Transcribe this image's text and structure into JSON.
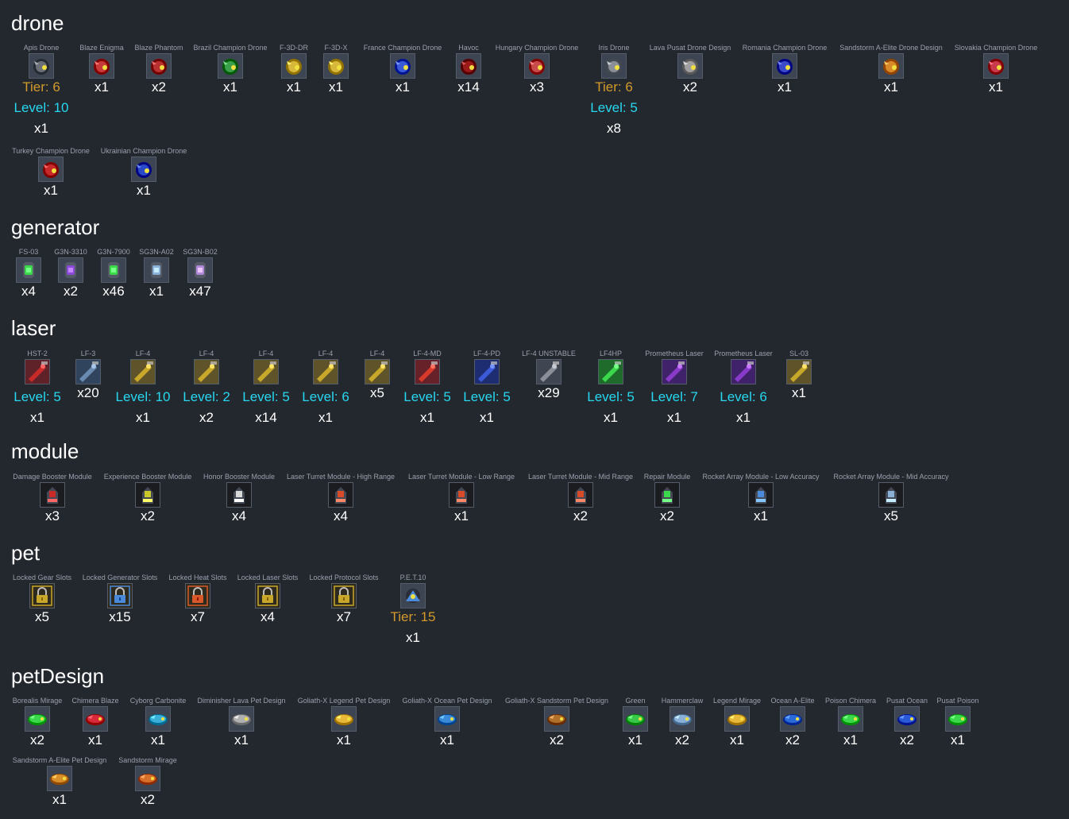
{
  "categories": [
    {
      "id": "drone",
      "title": "drone",
      "items": [
        {
          "name": "Apis Drone",
          "tier": "Tier: 6",
          "level": "Level: 10",
          "count": "x1",
          "icon": "apis-drone-icon",
          "color": "#6b6f77"
        },
        {
          "name": "Blaze Enigma",
          "count": "x1",
          "icon": "blaze-enigma-icon",
          "color": "#c83a3a"
        },
        {
          "name": "Blaze Phantom",
          "count": "x2",
          "icon": "blaze-phantom-icon",
          "color": "#b83030"
        },
        {
          "name": "Brazil Champion Drone",
          "count": "x1",
          "icon": "brazil-champion-drone-icon",
          "color": "#3aa04a"
        },
        {
          "name": "F-3D-DR",
          "count": "x1",
          "icon": "f-3d-dr-icon",
          "color": "#d8b83a"
        },
        {
          "name": "F-3D-X",
          "count": "x1",
          "icon": "f-3d-x-icon",
          "color": "#d8b83a"
        },
        {
          "name": "France Champion Drone",
          "count": "x1",
          "icon": "france-champion-drone-icon",
          "color": "#3a5ad8"
        },
        {
          "name": "Havoc",
          "count": "x14",
          "icon": "havoc-icon",
          "color": "#9a1a1a"
        },
        {
          "name": "Hungary Champion Drone",
          "count": "x3",
          "icon": "hungary-champion-drone-icon",
          "color": "#c84a4a"
        },
        {
          "name": "Iris Drone",
          "tier": "Tier: 6",
          "level": "Level: 5",
          "count": "x8",
          "icon": "iris-drone-icon",
          "color": "#8a8e96"
        },
        {
          "name": "Lava Pusat Drone Design",
          "count": "x2",
          "icon": "lava-pusat-drone-design-icon",
          "color": "#a0a0a0"
        },
        {
          "name": "Romania Champion Drone",
          "count": "x1",
          "icon": "romania-champion-drone-icon",
          "color": "#3a4ac8"
        },
        {
          "name": "Sandstorm A-Elite Drone Design",
          "count": "x1",
          "icon": "sandstorm-a-elite-drone-design-icon",
          "color": "#d88a2a"
        },
        {
          "name": "Slovakia Champion Drone",
          "count": "x1",
          "icon": "slovakia-champion-drone-icon",
          "color": "#c83a4a"
        },
        {
          "name": "Turkey Champion Drone",
          "count": "x1",
          "icon": "turkey-champion-drone-icon",
          "color": "#c82a2a"
        },
        {
          "name": "Ukrainian Champion Drone",
          "count": "x1",
          "icon": "ukrainian-champion-drone-icon",
          "color": "#2a4ac8"
        }
      ]
    },
    {
      "id": "generator",
      "title": "generator",
      "items": [
        {
          "name": "FS-03",
          "count": "x4",
          "icon": "fs-03-icon",
          "color": "#3ad84a"
        },
        {
          "name": "G3N-3310",
          "count": "x2",
          "icon": "g3n-3310-icon",
          "color": "#8a4ad8"
        },
        {
          "name": "G3N-7900",
          "count": "x46",
          "icon": "g3n-7900-icon",
          "color": "#3ad84a"
        },
        {
          "name": "SG3N-A02",
          "count": "x1",
          "icon": "sg3n-a02-icon",
          "color": "#8ab0d8"
        },
        {
          "name": "SG3N-B02",
          "count": "x47",
          "icon": "sg3n-b02-icon",
          "color": "#b08ad8"
        }
      ]
    },
    {
      "id": "laser",
      "title": "laser",
      "items": [
        {
          "name": "HST-2",
          "level": "Level: 5",
          "count": "x1",
          "icon": "hst-2-icon",
          "color": "#c82a2a"
        },
        {
          "name": "LF-3",
          "count": "x20",
          "icon": "lf-3-icon",
          "color": "#6a8ab0"
        },
        {
          "name": "LF-4",
          "level": "Level: 10",
          "count": "x1",
          "icon": "lf-4-icon",
          "color": "#c8a82a"
        },
        {
          "name": "LF-4",
          "level": "Level: 2",
          "count": "x2",
          "icon": "lf-4-icon",
          "color": "#c8a82a"
        },
        {
          "name": "LF-4",
          "level": "Level: 5",
          "count": "x14",
          "icon": "lf-4-icon",
          "color": "#c8a82a"
        },
        {
          "name": "LF-4",
          "level": "Level: 6",
          "count": "x1",
          "icon": "lf-4-icon",
          "color": "#c8a82a"
        },
        {
          "name": "LF-4",
          "count": "x5",
          "icon": "lf-4-icon",
          "color": "#c8a82a"
        },
        {
          "name": "LF-4-MD",
          "level": "Level: 5",
          "count": "x1",
          "icon": "lf-4-md-icon",
          "color": "#d83a2a"
        },
        {
          "name": "LF-4-PD",
          "level": "Level: 5",
          "count": "x1",
          "icon": "lf-4-pd-icon",
          "color": "#3a5ad8"
        },
        {
          "name": "LF-4 UNSTABLE",
          "count": "x29",
          "icon": "lf-4-unstable-icon",
          "color": "#8a8e96"
        },
        {
          "name": "LF4HP",
          "level": "Level: 5",
          "count": "x1",
          "icon": "lf4hp-icon",
          "color": "#3ad84a"
        },
        {
          "name": "Prometheus Laser",
          "level": "Level: 7",
          "count": "x1",
          "icon": "prometheus-laser-icon",
          "color": "#8a3ac8"
        },
        {
          "name": "Prometheus Laser",
          "level": "Level: 6",
          "count": "x1",
          "icon": "prometheus-laser-icon",
          "color": "#8a3ac8"
        },
        {
          "name": "SL-03",
          "count": "x1",
          "icon": "sl-03-icon",
          "color": "#c8a82a"
        }
      ]
    },
    {
      "id": "module",
      "title": "module",
      "items": [
        {
          "name": "Damage Booster Module",
          "count": "x3",
          "icon": "damage-booster-module-icon",
          "color": "#c82a2a"
        },
        {
          "name": "Experience Booster Module",
          "count": "x2",
          "icon": "experience-booster-module-icon",
          "color": "#c8c82a"
        },
        {
          "name": "Honor Booster Module",
          "count": "x4",
          "icon": "honor-booster-module-icon",
          "color": "#d8d8d8"
        },
        {
          "name": "Laser Turret Module - High Range",
          "count": "x4",
          "icon": "laser-turret-module-high-range-icon",
          "color": "#d84a2a"
        },
        {
          "name": "Laser Turret Module - Low Range",
          "count": "x1",
          "icon": "laser-turret-module-low-range-icon",
          "color": "#d84a2a"
        },
        {
          "name": "Laser Turret Module - Mid Range",
          "count": "x2",
          "icon": "laser-turret-module-mid-range-icon",
          "color": "#d84a2a"
        },
        {
          "name": "Repair Module",
          "count": "x2",
          "icon": "repair-module-icon",
          "color": "#3ad84a"
        },
        {
          "name": "Rocket Array Module - Low Accuracy",
          "count": "x1",
          "icon": "rocket-array-module-low-accuracy-icon",
          "color": "#4a8ad8"
        },
        {
          "name": "Rocket Array Module - Mid Accuracy",
          "count": "x5",
          "icon": "rocket-array-module-mid-accuracy-icon",
          "color": "#8ab0d8"
        }
      ]
    },
    {
      "id": "pet",
      "title": "pet",
      "items": [
        {
          "name": "Locked Gear Slots",
          "count": "x5",
          "icon": "locked-gear-slots-icon",
          "color": "#c8a82a"
        },
        {
          "name": "Locked Generator Slots",
          "count": "x15",
          "icon": "locked-generator-slots-icon",
          "color": "#4a8ad8"
        },
        {
          "name": "Locked Heat Slots",
          "count": "x7",
          "icon": "locked-heat-slots-icon",
          "color": "#d85a2a"
        },
        {
          "name": "Locked Laser Slots",
          "count": "x4",
          "icon": "locked-laser-slots-icon",
          "color": "#c8a82a"
        },
        {
          "name": "Locked Protocol Slots",
          "count": "x7",
          "icon": "locked-protocol-slots-icon",
          "color": "#c8a82a"
        },
        {
          "name": "P.E.T.10",
          "tier": "Tier: 15",
          "count": "x1",
          "icon": "pet-10-icon",
          "color": "#4a8ad8"
        }
      ]
    },
    {
      "id": "petDesign",
      "title": "petDesign",
      "items": [
        {
          "name": "Borealis Mirage",
          "count": "x2",
          "icon": "borealis-mirage-icon",
          "color": "#3ad84a"
        },
        {
          "name": "Chimera Blaze",
          "count": "x1",
          "icon": "chimera-blaze-icon",
          "color": "#d82a3a"
        },
        {
          "name": "Cyborg Carbonite",
          "count": "x1",
          "icon": "cyborg-carbonite-icon",
          "color": "#3ab0d8"
        },
        {
          "name": "Diminisher Lava Pet Design",
          "count": "x1",
          "icon": "diminisher-lava-pet-design-icon",
          "color": "#b0b0b0"
        },
        {
          "name": "Goliath-X Legend Pet Design",
          "count": "x1",
          "icon": "goliath-x-legend-pet-design-icon",
          "color": "#e8b83a"
        },
        {
          "name": "Goliath-X Ocean Pet Design",
          "count": "x1",
          "icon": "goliath-x-ocean-pet-design-icon",
          "color": "#3a8ad8"
        },
        {
          "name": "Goliath-X Sandstorm Pet Design",
          "count": "x2",
          "icon": "goliath-x-sandstorm-pet-design-icon",
          "color": "#b0702a"
        },
        {
          "name": "Green",
          "count": "x1",
          "icon": "green-icon",
          "color": "#3ac84a"
        },
        {
          "name": "Hammerclaw",
          "count": "x2",
          "icon": "hammerclaw-icon",
          "color": "#8ab0d8"
        },
        {
          "name": "Legend Mirage",
          "count": "x1",
          "icon": "legend-mirage-icon",
          "color": "#e8b83a"
        },
        {
          "name": "Ocean A-Elite",
          "count": "x2",
          "icon": "ocean-a-elite-icon",
          "color": "#2a6ad8"
        },
        {
          "name": "Poison Chimera",
          "count": "x1",
          "icon": "poison-chimera-icon",
          "color": "#3ad84a"
        },
        {
          "name": "Pusat Ocean",
          "count": "x2",
          "icon": "pusat-ocean-icon",
          "color": "#2a5ad8"
        },
        {
          "name": "Pusat Poison",
          "count": "x1",
          "icon": "pusat-poison-icon",
          "color": "#3ad84a"
        },
        {
          "name": "Sandstorm A-Elite Pet Design",
          "count": "x1",
          "icon": "sandstorm-a-elite-pet-design-icon",
          "color": "#d8902a"
        },
        {
          "name": "Sandstorm Mirage",
          "count": "x2",
          "icon": "sandstorm-mirage-icon",
          "color": "#d8702a"
        }
      ]
    }
  ]
}
